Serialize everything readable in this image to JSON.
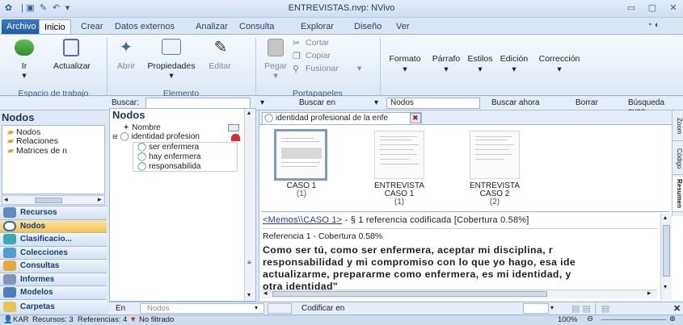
{
  "window": {
    "title": "ENTREVISTAS.nvp: NVivo"
  },
  "tabs": [
    "Archivo",
    "Inicio",
    "Crear",
    "Datos externos",
    "Analizar",
    "Consulta",
    "Explorar",
    "Diseño",
    "Ver"
  ],
  "ribbon": {
    "workspace": {
      "ir": "Ir",
      "actualizar": "Actualizar",
      "group": "Espacio de trabajo"
    },
    "element": {
      "abrir": "Abrir",
      "propiedades": "Propiedades",
      "editar": "Editar",
      "group": "Elemento"
    },
    "clipboard": {
      "pegar": "Pegar",
      "cortar": "Cortar",
      "copiar": "Copiar",
      "fusionar": "Fusionar",
      "group": "Portapapeles"
    },
    "format": {
      "formato": "Formato",
      "parrafo": "Párrafo",
      "estilos": "Estilos",
      "edicion": "Edición",
      "correccion": "Corrección"
    }
  },
  "findbar": {
    "buscar": "Buscar:",
    "buscar_en": "Buscar en",
    "scope": "Nodos",
    "buscar_ahora": "Buscar ahora",
    "borrar": "Borrar",
    "busqueda_avanzada": "Búsqueda avan"
  },
  "nav": {
    "title": "Nodos",
    "tree": [
      "Nodos",
      "Relaciones",
      "Matrices de n"
    ],
    "buttons": [
      "Recursos",
      "Nodos",
      "Clasificacio...",
      "Colecciones",
      "Consultas",
      "Informes",
      "Modelos",
      "Carpetas"
    ]
  },
  "nodes": {
    "title": "Nodos",
    "column": "Nombre",
    "parent": "identidad profesion",
    "children": [
      "ser enfermera",
      "hay enfermera",
      "responsabilida"
    ]
  },
  "doc": {
    "tab": "identidad profesional de la enfe",
    "thumbs": [
      {
        "caption": "CASO 1",
        "num": "(1)"
      },
      {
        "caption": "ENTREVISTA\nCASO 1",
        "num": "(1)"
      },
      {
        "caption": "ENTREVISTA\nCASO 2",
        "num": "(2)"
      }
    ],
    "side_tabs": [
      "Zoom",
      "Código",
      "Resumen"
    ],
    "memo_link": "<Memos\\\\CASO 1>",
    "memo_rest": " - § 1 referencia codificada  [Cobertura 0.58%]",
    "ref": "Referencia 1 - Cobertura 0.58%",
    "quote": [
      "Como ser tú, como ser enfermera, aceptar mi disciplina, r",
      "responsabilidad y mi compromiso con lo que yo hago, esa ide",
      "actualizarme, prepararme como enfermera, es mi identidad, y",
      "otra identidad\""
    ]
  },
  "codebar": {
    "en": "En",
    "nodos": "Nodos",
    "codificar": "Codificar en"
  },
  "status": {
    "user": "KAR",
    "recursos": "Recursos: 3",
    "referencias": "Referencias: 4",
    "filtro": "No filtrado",
    "zoom": "100%"
  }
}
